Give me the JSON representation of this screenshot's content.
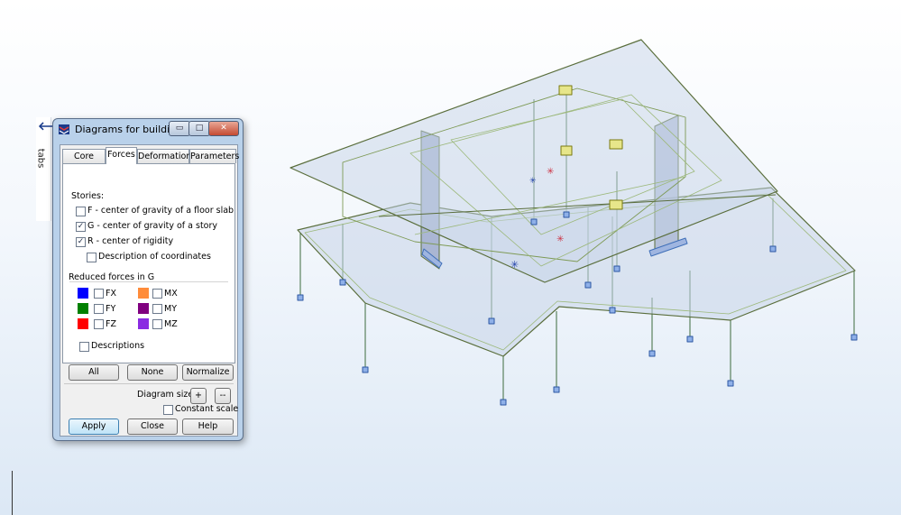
{
  "dialog": {
    "title": "Diagrams for buildings",
    "window_controls": {
      "minimize": "▭",
      "maximize": "□",
      "close": "✕"
    },
    "tabs": [
      {
        "label": "Core walls",
        "selected": false
      },
      {
        "label": "Forces",
        "selected": true
      },
      {
        "label": "Deformations",
        "selected": false
      },
      {
        "label": "Parameters",
        "selected": false
      }
    ],
    "stories": {
      "heading": "Stories:",
      "options": [
        {
          "label": "F - center of gravity of a floor slab",
          "checked": false
        },
        {
          "label": "G - center of gravity of a story",
          "checked": true
        },
        {
          "label": "R - center of rigidity",
          "checked": true
        },
        {
          "label": "Description of coordinates",
          "checked": false
        }
      ]
    },
    "reduced_forces": {
      "heading": "Reduced forces in G",
      "items": [
        {
          "label": "FX",
          "color": "#0000ff",
          "checked": false
        },
        {
          "label": "FY",
          "color": "#008000",
          "checked": false
        },
        {
          "label": "FZ",
          "color": "#ff0000",
          "checked": false
        },
        {
          "label": "MX",
          "color": "#ff8c3a",
          "checked": false
        },
        {
          "label": "MY",
          "color": "#800080",
          "checked": false
        },
        {
          "label": "MZ",
          "color": "#8a2be2",
          "checked": false
        }
      ],
      "descriptions": {
        "label": "Descriptions",
        "checked": false
      }
    },
    "buttons": {
      "all": "All",
      "none": "None",
      "normalize": "Normalize",
      "apply": "Apply",
      "close": "Close",
      "help": "Help"
    },
    "diagram_size": {
      "label": "Diagram size:",
      "plus": "+",
      "minus": "--"
    },
    "constant_scale": {
      "label": "Constant scale",
      "checked": false
    }
  },
  "tabs_strip": {
    "label": "tabs",
    "arrow": "🡐"
  },
  "colors": {
    "slab_fill": "#c6d3e8",
    "slab_edge": "#5a6e3c",
    "column": "#3d6b3d",
    "support": "#3f6fb8",
    "wall": "#aab6d3"
  }
}
